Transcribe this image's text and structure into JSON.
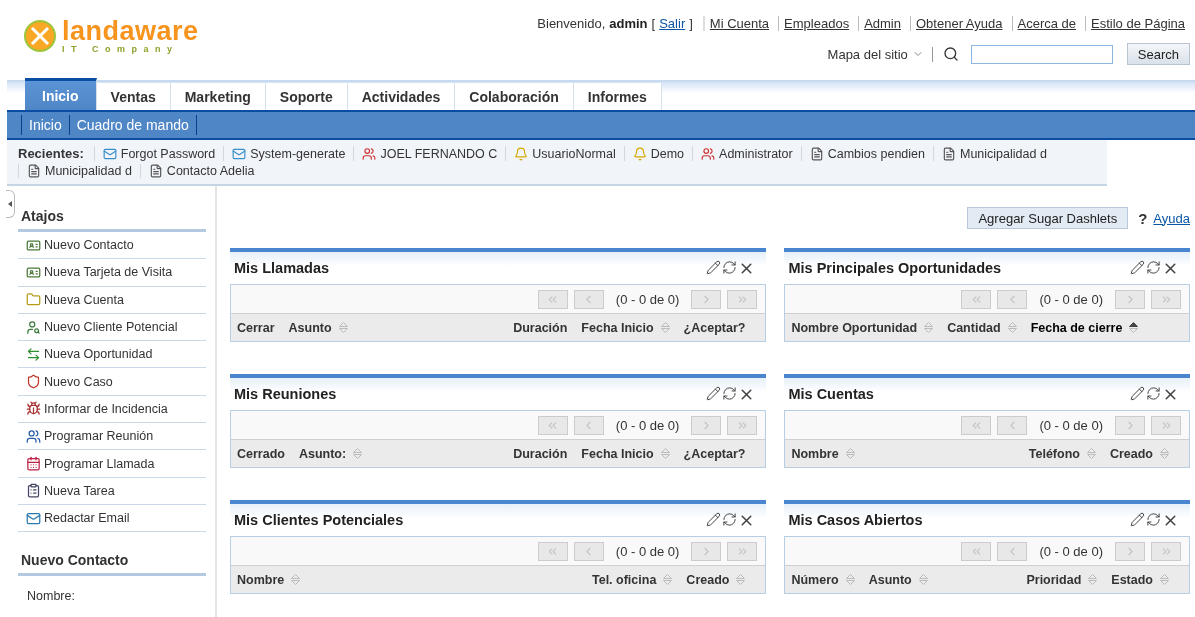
{
  "logo": {
    "name": "landaware",
    "tagline": "IT Company"
  },
  "welcome": {
    "greeting": "Bienvenido,",
    "user": "admin",
    "bracket_open": "[",
    "logout": "Salir",
    "bracket_close": "]"
  },
  "top_links": [
    "Mi Cuenta",
    "Empleados",
    "Admin",
    "Obtener Ayuda",
    "Acerca de",
    "Estilo de Página"
  ],
  "sitemap": "Mapa del sitio",
  "search": {
    "button": "Search"
  },
  "tabs": [
    {
      "label": "Inicio",
      "selected": true
    },
    {
      "label": "Ventas",
      "selected": false
    },
    {
      "label": "Marketing",
      "selected": false
    },
    {
      "label": "Soporte",
      "selected": false
    },
    {
      "label": "Actividades",
      "selected": false
    },
    {
      "label": "Colaboración",
      "selected": false
    },
    {
      "label": "Informes",
      "selected": false
    }
  ],
  "subtabs": [
    "Inicio",
    "Cuadro de mando"
  ],
  "recent": {
    "label": "Recientes:",
    "items": [
      {
        "label": "Forgot Password",
        "kind": "email"
      },
      {
        "label": "System-generate",
        "kind": "email"
      },
      {
        "label": "JOEL FERNANDO C",
        "kind": "user"
      },
      {
        "label": "UsuarioNormal",
        "kind": "role"
      },
      {
        "label": "Demo",
        "kind": "role"
      },
      {
        "label": "Administrator",
        "kind": "user"
      },
      {
        "label": "Cambios pendien",
        "kind": "record"
      },
      {
        "label": "Municipalidad d",
        "kind": "record"
      },
      {
        "label": "Municipalidad d",
        "kind": "record"
      },
      {
        "label": "Contacto Adelia",
        "kind": "record"
      }
    ]
  },
  "sidebar": {
    "title": "Atajos",
    "shortcuts": [
      {
        "label": "Nuevo Contacto",
        "kind": "contact"
      },
      {
        "label": "Nueva Tarjeta de Visita",
        "kind": "contact"
      },
      {
        "label": "Nueva Cuenta",
        "kind": "account"
      },
      {
        "label": "Nuevo Cliente Potencial",
        "kind": "lead"
      },
      {
        "label": "Nueva Oportunidad",
        "kind": "opportunity"
      },
      {
        "label": "Nuevo Caso",
        "kind": "case"
      },
      {
        "label": "Informar de Incidencia",
        "kind": "bug"
      },
      {
        "label": "Programar Reunión",
        "kind": "meeting"
      },
      {
        "label": "Programar Llamada",
        "kind": "call"
      },
      {
        "label": "Nueva Tarea",
        "kind": "task"
      },
      {
        "label": "Redactar Email",
        "kind": "email"
      }
    ],
    "form_title": "Nuevo Contacto",
    "form_label": "Nombre:"
  },
  "toolbar": {
    "button": "Agregar Sugar Dashlets",
    "help_mark": "?",
    "help": "Ayuda"
  },
  "dashlets": [
    [
      {
        "title": "Mis Llamadas",
        "paging": "(0 - 0 de 0)",
        "columns_left": [
          {
            "label": "Cerrar",
            "sortable": false,
            "sorted": false
          },
          {
            "label": "Asunto",
            "sortable": true,
            "sorted": false
          }
        ],
        "columns_right": [
          {
            "label": "Duración",
            "sortable": false,
            "sorted": false
          },
          {
            "label": "Fecha Inicio",
            "sortable": true,
            "sorted": false
          },
          {
            "label": "¿Aceptar?",
            "sortable": false,
            "sorted": false
          }
        ]
      },
      {
        "title": "Mis Reuniones",
        "paging": "(0 - 0 de 0)",
        "columns_left": [
          {
            "label": "Cerrado",
            "sortable": false,
            "sorted": false
          },
          {
            "label": "Asunto:",
            "sortable": true,
            "sorted": false
          }
        ],
        "columns_right": [
          {
            "label": "Duración",
            "sortable": false,
            "sorted": false
          },
          {
            "label": "Fecha Inicio",
            "sortable": true,
            "sorted": false
          },
          {
            "label": "¿Aceptar?",
            "sortable": false,
            "sorted": false
          }
        ]
      },
      {
        "title": "Mis Clientes Potenciales",
        "paging": "(0 - 0 de 0)",
        "columns_left": [
          {
            "label": "Nombre",
            "sortable": true,
            "sorted": false
          }
        ],
        "columns_right": [
          {
            "label": "Tel. oficina",
            "sortable": true,
            "sorted": false
          },
          {
            "label": "Creado",
            "sortable": true,
            "sorted": false
          }
        ]
      }
    ],
    [
      {
        "title": "Mis Principales Oportunidades",
        "paging": "(0 - 0 de 0)",
        "columns_left": [
          {
            "label": "Nombre Oportunidad",
            "sortable": true,
            "sorted": false
          },
          {
            "label": "Cantidad",
            "sortable": true,
            "sorted": false
          },
          {
            "label": "Fecha de cierre",
            "sortable": true,
            "sorted": true
          }
        ]
      },
      {
        "title": "Mis Cuentas",
        "paging": "(0 - 0 de 0)",
        "columns_left": [
          {
            "label": "Nombre",
            "sortable": true,
            "sorted": false
          }
        ],
        "columns_right": [
          {
            "label": "Teléfono",
            "sortable": true,
            "sorted": false
          },
          {
            "label": "Creado",
            "sortable": true,
            "sorted": false
          }
        ]
      },
      {
        "title": "Mis Casos Abiertos",
        "paging": "(0 - 0 de 0)",
        "columns_left": [
          {
            "label": "Número",
            "sortable": true,
            "sorted": false
          },
          {
            "label": "Asunto",
            "sortable": true,
            "sorted": false
          }
        ],
        "columns_right": [
          {
            "label": "Prioridad",
            "sortable": true,
            "sorted": false
          },
          {
            "label": "Estado",
            "sortable": true,
            "sorted": false
          }
        ]
      }
    ]
  ]
}
